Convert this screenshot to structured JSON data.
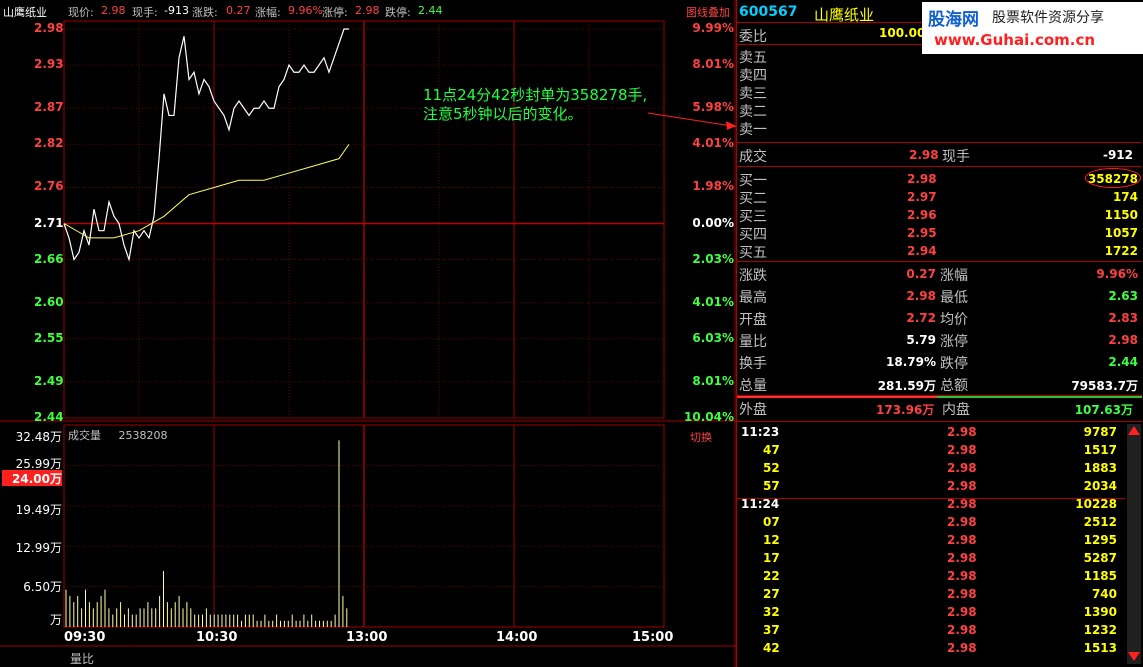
{
  "window": {
    "stock_name": "山鹰纸业",
    "overlay_btn": "图线叠加",
    "switch_btn": "切换"
  },
  "topbar": {
    "price_label": "现价:",
    "price_value": "2.98",
    "hand_label": "现手:",
    "hand_value": "-913",
    "change_label": "涨跌:",
    "change_value": "0.27",
    "pct_label": "涨幅:",
    "pct_value": "9.96%",
    "limitup_label": "涨停:",
    "limitup_value": "2.98",
    "limitdown_label": "跌停:",
    "limitdown_value": "2.44"
  },
  "price_axis": [
    "2.98",
    "2.93",
    "2.87",
    "2.82",
    "2.76",
    "2.71",
    "2.66",
    "2.60",
    "2.55",
    "2.49",
    "2.44"
  ],
  "pct_axis": [
    "9.99%",
    "8.01%",
    "5.98%",
    "4.01%",
    "1.98%",
    "0.00%",
    "2.03%",
    "4.01%",
    "6.03%",
    "8.01%",
    "10.04%"
  ],
  "vol_axis": [
    "32.48万",
    "25.99万",
    "24.00万",
    "19.49万",
    "12.99万",
    "6.50万",
    "万"
  ],
  "time_axis": [
    "09:30",
    "10:30",
    "13:00",
    "14:00",
    "15:00"
  ],
  "volume_header": {
    "label": "成交量",
    "value": "2538208"
  },
  "bottom_tab": "量比",
  "annotation": {
    "line1": "11点24分42秒封单为358278手,",
    "line2": "注意5秒钟以后的变化。"
  },
  "watermark": {
    "logo": "股海网",
    "slogan": "股票软件资源分享",
    "url": "www.Guhai.com.cn"
  },
  "panel": {
    "code": "600567",
    "name": "山鹰纸业",
    "commission_label": "委比",
    "commission_value": "100.00",
    "sell_labels": [
      "卖五",
      "卖四",
      "卖三",
      "卖二",
      "卖一"
    ],
    "deal_label": "成交",
    "deal_value": "2.98",
    "now_hand_label": "现手",
    "now_hand_value": "-912",
    "buys": [
      {
        "label": "买一",
        "price": "2.98",
        "vol": "358278"
      },
      {
        "label": "买二",
        "price": "2.97",
        "vol": "174"
      },
      {
        "label": "买三",
        "price": "2.96",
        "vol": "1150"
      },
      {
        "label": "买四",
        "price": "2.95",
        "vol": "1057"
      },
      {
        "label": "买五",
        "price": "2.94",
        "vol": "1722"
      }
    ],
    "stats": [
      {
        "l1": "涨跌",
        "v1": "0.27",
        "c1": "red",
        "l2": "涨幅",
        "v2": "9.96%",
        "c2": "red"
      },
      {
        "l1": "最高",
        "v1": "2.98",
        "c1": "red",
        "l2": "最低",
        "v2": "2.63",
        "c2": "grn"
      },
      {
        "l1": "开盘",
        "v1": "2.72",
        "c1": "red",
        "l2": "均价",
        "v2": "2.83",
        "c2": "red"
      },
      {
        "l1": "量比",
        "v1": "5.79",
        "c1": "wht",
        "l2": "涨停",
        "v2": "2.98",
        "c2": "red"
      },
      {
        "l1": "换手",
        "v1": "18.79%",
        "c1": "wht",
        "l2": "跌停",
        "v2": "2.44",
        "c2": "grn"
      },
      {
        "l1": "总量",
        "v1": "281.59万",
        "c1": "wht",
        "l2": "总额",
        "v2": "79583.7万",
        "c2": "wht"
      }
    ],
    "outer_label": "外盘",
    "outer_value": "173.96万",
    "inner_label": "内盘",
    "inner_value": "107.63万",
    "ticks": [
      {
        "t": "11:23",
        "p": "2.98",
        "v": "9787"
      },
      {
        "t": "47",
        "p": "2.98",
        "v": "1517"
      },
      {
        "t": "52",
        "p": "2.98",
        "v": "1883"
      },
      {
        "t": "57",
        "p": "2.98",
        "v": "2034"
      },
      {
        "t": "11:24",
        "p": "2.98",
        "v": "10228"
      },
      {
        "t": "07",
        "p": "2.98",
        "v": "2512"
      },
      {
        "t": "12",
        "p": "2.98",
        "v": "1295"
      },
      {
        "t": "17",
        "p": "2.98",
        "v": "5287"
      },
      {
        "t": "22",
        "p": "2.98",
        "v": "1185"
      },
      {
        "t": "27",
        "p": "2.98",
        "v": "740"
      },
      {
        "t": "32",
        "p": "2.98",
        "v": "1390"
      },
      {
        "t": "37",
        "p": "2.98",
        "v": "1232"
      },
      {
        "t": "42",
        "p": "2.98",
        "v": "1513"
      }
    ]
  },
  "chart_data": {
    "type": "line",
    "ylim": [
      2.44,
      2.98
    ],
    "x_minutes_range": [
      0,
      240
    ],
    "series": [
      {
        "values_minutes": [
          0,
          2,
          4,
          6,
          8,
          10,
          12,
          14,
          16,
          18,
          20,
          22,
          24,
          26,
          28,
          30,
          32,
          34,
          36,
          38,
          40,
          42,
          44,
          46,
          48,
          50,
          52,
          54,
          56,
          58,
          60,
          62,
          64,
          66,
          68,
          70,
          72,
          74,
          76,
          78,
          80,
          82,
          84,
          86,
          88,
          90,
          92,
          94,
          96,
          98,
          100,
          102,
          104,
          106,
          108,
          110,
          112,
          114
        ],
        "price": [
          2.71,
          2.69,
          2.66,
          2.67,
          2.7,
          2.68,
          2.73,
          2.7,
          2.7,
          2.74,
          2.72,
          2.71,
          2.68,
          2.66,
          2.7,
          2.69,
          2.7,
          2.69,
          2.72,
          2.8,
          2.89,
          2.86,
          2.86,
          2.94,
          2.97,
          2.91,
          2.92,
          2.89,
          2.91,
          2.9,
          2.88,
          2.87,
          2.86,
          2.84,
          2.87,
          2.88,
          2.87,
          2.86,
          2.87,
          2.87,
          2.88,
          2.87,
          2.87,
          2.9,
          2.91,
          2.93,
          2.92,
          2.92,
          2.93,
          2.92,
          2.92,
          2.93,
          2.94,
          2.92,
          2.94,
          2.96,
          2.98,
          2.98
        ]
      },
      {
        "values_minutes": [
          0,
          10,
          20,
          30,
          40,
          50,
          60,
          70,
          80,
          90,
          100,
          110,
          114
        ],
        "avg": [
          2.71,
          2.69,
          2.69,
          2.7,
          2.72,
          2.75,
          2.76,
          2.77,
          2.77,
          2.78,
          2.79,
          2.8,
          2.82
        ]
      }
    ],
    "volume": [
      6,
      5,
      4,
      5,
      3,
      6,
      4,
      3,
      4,
      5,
      6,
      3,
      2,
      3,
      4,
      2,
      3,
      2,
      2,
      3,
      3,
      4,
      3,
      3,
      5,
      9,
      4,
      3,
      4,
      5,
      3,
      4,
      3,
      2,
      2,
      2,
      3,
      2,
      2,
      2,
      2,
      2,
      2,
      2,
      2,
      1,
      2,
      2,
      2,
      1,
      1,
      2,
      1,
      1,
      2,
      1,
      1,
      1,
      2,
      1,
      1,
      2,
      1,
      2,
      1,
      1,
      1,
      1,
      1,
      2,
      30,
      5,
      3
    ],
    "volume_ylim": [
      0,
      32.48
    ]
  }
}
